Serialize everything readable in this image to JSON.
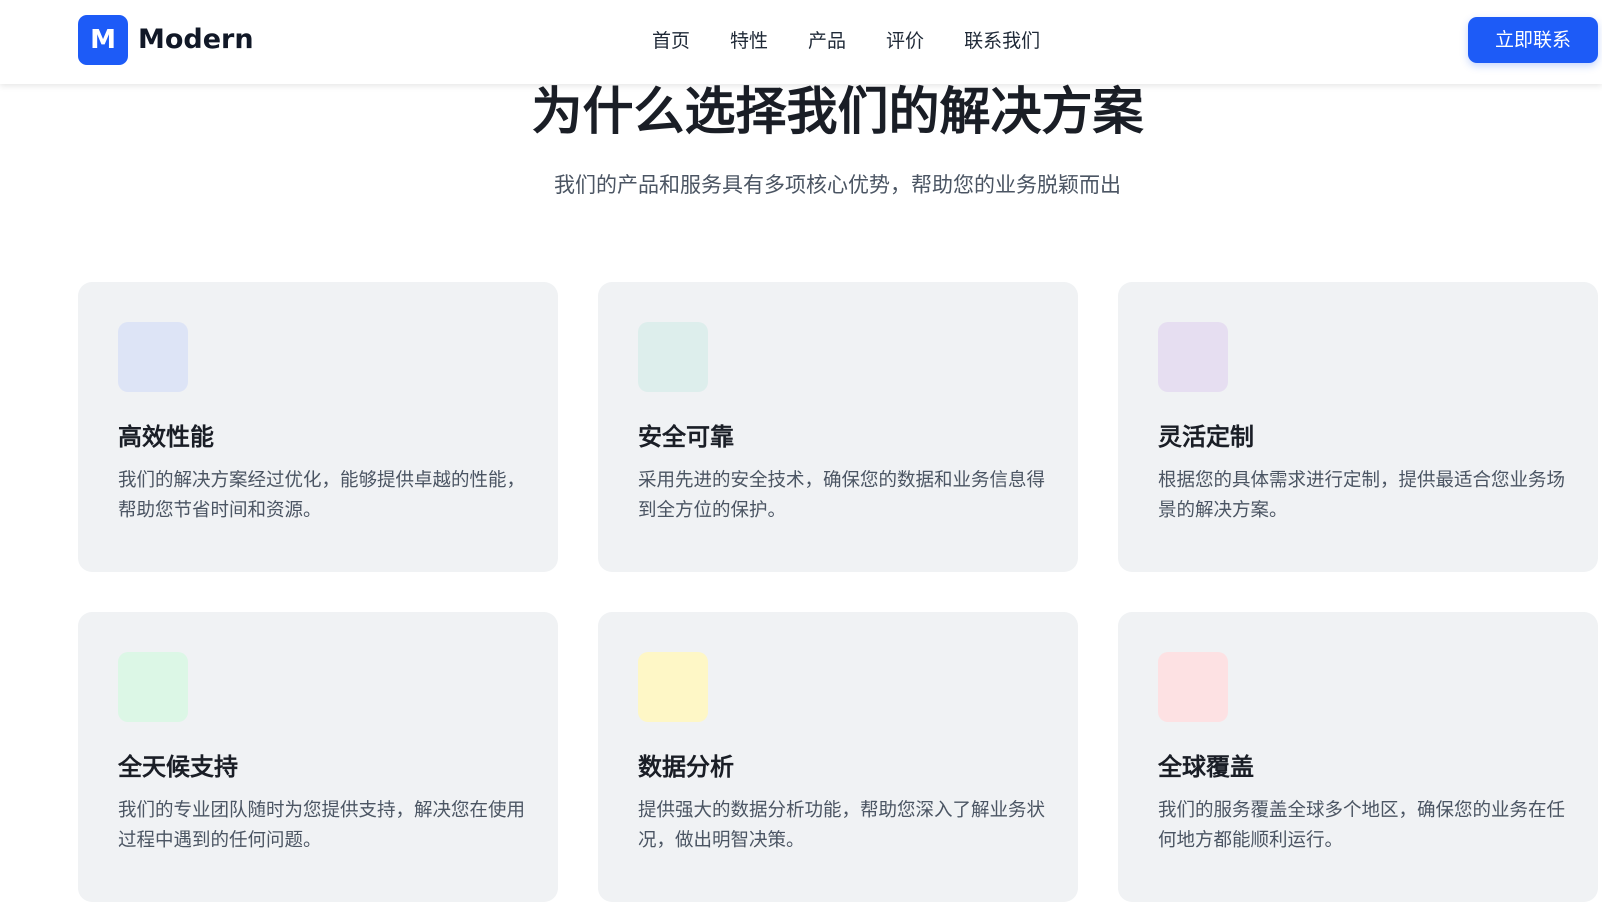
{
  "header": {
    "logo_letter": "M",
    "logo_text": "Modern",
    "nav": [
      "首页",
      "特性",
      "产品",
      "评价",
      "联系我们"
    ],
    "cta_label": "立即联系"
  },
  "hero": {
    "title": "为什么选择我们的解决方案",
    "subtitle": "我们的产品和服务具有多项核心优势，帮助您的业务脱颖而出"
  },
  "features": [
    {
      "title": "高效性能",
      "desc": "我们的解决方案经过优化，能够提供卓越的性能，帮助您节省时间和资源。",
      "icon_color": "#dde4f6"
    },
    {
      "title": "安全可靠",
      "desc": "采用先进的安全技术，确保您的数据和业务信息得到全方位的保护。",
      "icon_color": "#ddeeec"
    },
    {
      "title": "灵活定制",
      "desc": "根据您的具体需求进行定制，提供最适合您业务场景的解决方案。",
      "icon_color": "#e6def1"
    },
    {
      "title": "全天候支持",
      "desc": "我们的专业团队随时为您提供支持，解决您在使用过程中遇到的任何问题。",
      "icon_color": "#dcf7e6"
    },
    {
      "title": "数据分析",
      "desc": "提供强大的数据分析功能，帮助您深入了解业务状况，做出明智决策。",
      "icon_color": "#fef7c6"
    },
    {
      "title": "全球覆盖",
      "desc": "我们的服务覆盖全球多个地区，确保您的业务在任何地方都能顺利运行。",
      "icon_color": "#fde1e3"
    }
  ]
}
